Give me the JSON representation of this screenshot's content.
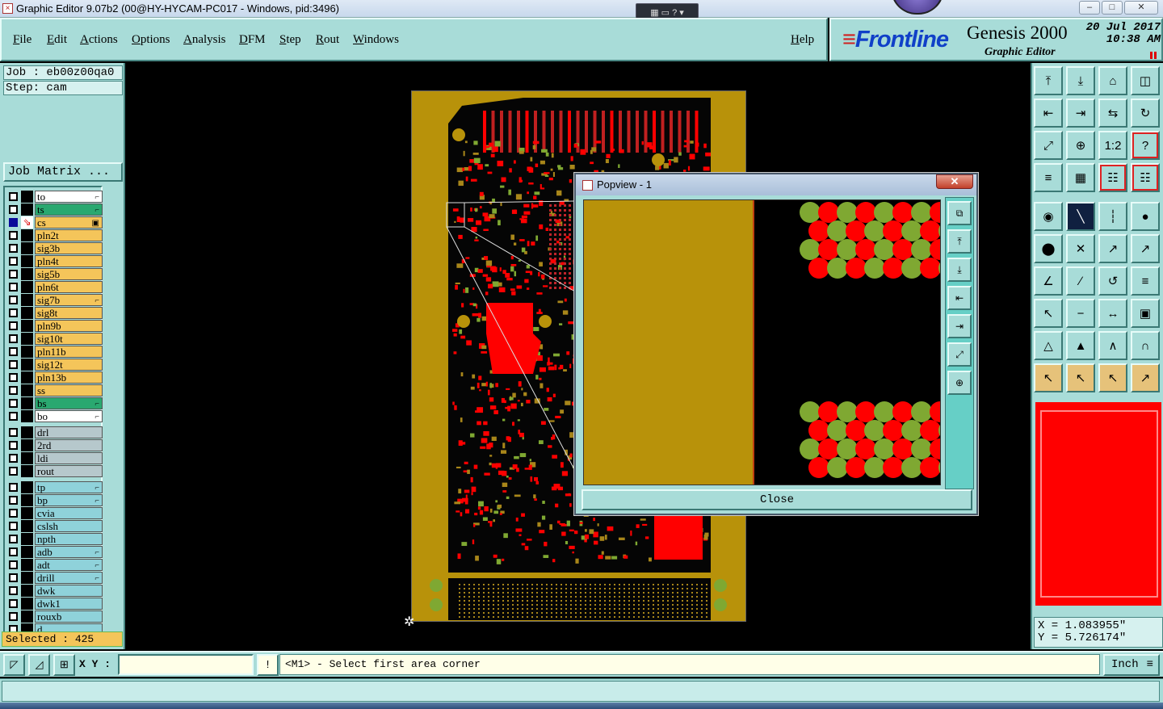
{
  "window": {
    "title": "Graphic Editor 9.07b2 (00@HY-HYCAM-PC017 - Windows, pid:3496)",
    "min": "–",
    "max": "□",
    "close": "✕"
  },
  "menu": [
    "File",
    "Edit",
    "Actions",
    "Options",
    "Analysis",
    "DFM",
    "Step",
    "Rout",
    "Windows"
  ],
  "help": "Help",
  "brand": {
    "logo": "Frontline",
    "product": "Genesis 2000",
    "subtitle": "Graphic Editor",
    "date": "20 Jul 2017",
    "time": "10:38 AM"
  },
  "job": {
    "job_label": "Job : eb00z00qa0",
    "step_label": "Step: cam",
    "matrix_button": "Job Matrix ..."
  },
  "layers": [
    {
      "name": "to",
      "color": "#ffffff",
      "flag": "⌐"
    },
    {
      "name": "ts",
      "color": "#2aa870",
      "flag": "⌐"
    },
    {
      "name": "cs",
      "color": "#f4c55a",
      "flag": "▣",
      "work": true
    },
    {
      "name": "pln2t",
      "color": "#f4c55a"
    },
    {
      "name": "sig3b",
      "color": "#f4c55a"
    },
    {
      "name": "pln4t",
      "color": "#f4c55a"
    },
    {
      "name": "sig5b",
      "color": "#f4c55a"
    },
    {
      "name": "pln6t",
      "color": "#f4c55a"
    },
    {
      "name": "sig7b",
      "color": "#f4c55a",
      "flag": "⌐"
    },
    {
      "name": "sig8t",
      "color": "#f4c55a"
    },
    {
      "name": "pln9b",
      "color": "#f4c55a"
    },
    {
      "name": "sig10t",
      "color": "#f4c55a"
    },
    {
      "name": "pln11b",
      "color": "#f4c55a"
    },
    {
      "name": "sig12t",
      "color": "#f4c55a"
    },
    {
      "name": "pln13b",
      "color": "#f4c55a"
    },
    {
      "name": "ss",
      "color": "#f4c55a"
    },
    {
      "name": "bs",
      "color": "#2aa870",
      "flag": "⌐"
    },
    {
      "name": "bo",
      "color": "#ffffff",
      "flag": "⌐"
    },
    {
      "name": "drl",
      "color": "#b6c8cc",
      "gap": true
    },
    {
      "name": "2rd",
      "color": "#b6c8cc"
    },
    {
      "name": "ldi",
      "color": "#b6c8cc"
    },
    {
      "name": "rout",
      "color": "#b6c8cc"
    },
    {
      "name": "tp",
      "color": "#8fd2da",
      "flag": "⌐",
      "gap": true
    },
    {
      "name": "bp",
      "color": "#8fd2da",
      "flag": "⌐"
    },
    {
      "name": "cvia",
      "color": "#8fd2da"
    },
    {
      "name": "cslsh",
      "color": "#8fd2da"
    },
    {
      "name": "npth",
      "color": "#8fd2da"
    },
    {
      "name": "adb",
      "color": "#8fd2da",
      "flag": "⌐"
    },
    {
      "name": "adt",
      "color": "#8fd2da",
      "flag": "⌐"
    },
    {
      "name": "drill",
      "color": "#8fd2da",
      "flag": "⌐"
    },
    {
      "name": "dwk",
      "color": "#8fd2da"
    },
    {
      "name": "dwk1",
      "color": "#8fd2da"
    },
    {
      "name": "rouxb",
      "color": "#8fd2da"
    },
    {
      "name": "d",
      "color": "#8fd2da"
    }
  ],
  "selected": "Selected : 425",
  "popview": {
    "title": "Popview - 1",
    "close_label": "Close"
  },
  "coords": {
    "x": "X = 1.083955\"",
    "y": "Y = 5.726174\""
  },
  "status": {
    "xy_label": "X Y :",
    "xy_value": "",
    "alert": "!",
    "prompt": "<M1> - Select first area corner",
    "unit": "Inch"
  },
  "colors": {
    "panel": "#a8dcd8",
    "copper": "#b8920a",
    "pad_red": "#ff0000",
    "pad_green": "#7fa832"
  }
}
